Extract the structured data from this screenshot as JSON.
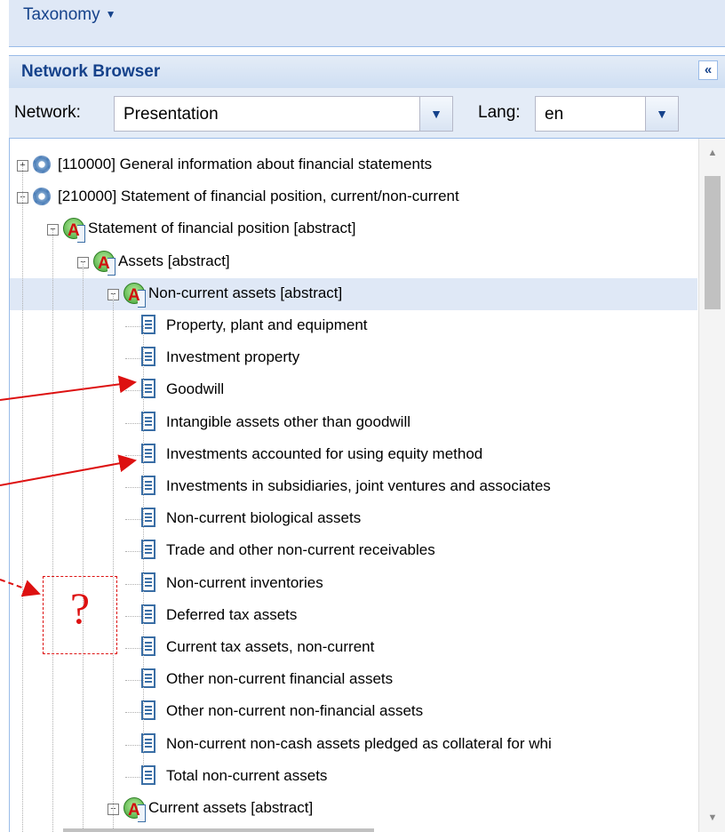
{
  "menu": {
    "label": "Taxonomy"
  },
  "panel": {
    "title": "Network Browser",
    "collapse_glyph": "«"
  },
  "toolbar": {
    "network_label": "Network:",
    "network_value": "Presentation",
    "lang_label": "Lang:",
    "lang_value": "en"
  },
  "tree": {
    "rows": [
      {
        "text": "[110000] General information about financial statements",
        "level": 0,
        "icon": "gear-icon",
        "expander": "+"
      },
      {
        "text": "[210000] Statement of financial position, current/non-current",
        "level": 0,
        "icon": "gear-icon",
        "expander": "-"
      },
      {
        "text": "Statement of financial position [abstract]",
        "level": 1,
        "icon": "abstract-icon",
        "expander": "-"
      },
      {
        "text": "Assets [abstract]",
        "level": 2,
        "icon": "abstract-icon",
        "expander": "-"
      },
      {
        "text": "Non-current assets [abstract]",
        "level": 3,
        "icon": "abstract-icon",
        "expander": "-",
        "selected": true
      },
      {
        "text": "Property, plant and equipment",
        "level": 4,
        "icon": "document-icon"
      },
      {
        "text": "Investment property",
        "level": 4,
        "icon": "document-icon"
      },
      {
        "text": "Goodwill",
        "level": 4,
        "icon": "document-icon"
      },
      {
        "text": "Intangible assets other than goodwill",
        "level": 4,
        "icon": "document-icon"
      },
      {
        "text": "Investments accounted for using equity method",
        "level": 4,
        "icon": "document-icon"
      },
      {
        "text": "Investments in subsidiaries, joint ventures and associates",
        "level": 4,
        "icon": "document-icon"
      },
      {
        "text": "Non-current biological assets",
        "level": 4,
        "icon": "document-icon"
      },
      {
        "text": "Trade and other non-current receivables",
        "level": 4,
        "icon": "document-icon"
      },
      {
        "text": "Non-current inventories",
        "level": 4,
        "icon": "document-icon"
      },
      {
        "text": "Deferred tax assets",
        "level": 4,
        "icon": "document-icon"
      },
      {
        "text": "Current tax assets, non-current",
        "level": 4,
        "icon": "document-icon"
      },
      {
        "text": "Other non-current financial assets",
        "level": 4,
        "icon": "document-icon"
      },
      {
        "text": "Other non-current non-financial assets",
        "level": 4,
        "icon": "document-icon"
      },
      {
        "text": "Non-current non-cash assets pledged as collateral for whi",
        "level": 4,
        "icon": "document-icon"
      },
      {
        "text": "Total non-current assets",
        "level": 4,
        "icon": "document-icon"
      },
      {
        "text": "Current assets [abstract]",
        "level": 3,
        "icon": "abstract-icon",
        "expander": "-"
      }
    ]
  },
  "annotation": {
    "question_mark": "?",
    "color": "#dd1111"
  }
}
